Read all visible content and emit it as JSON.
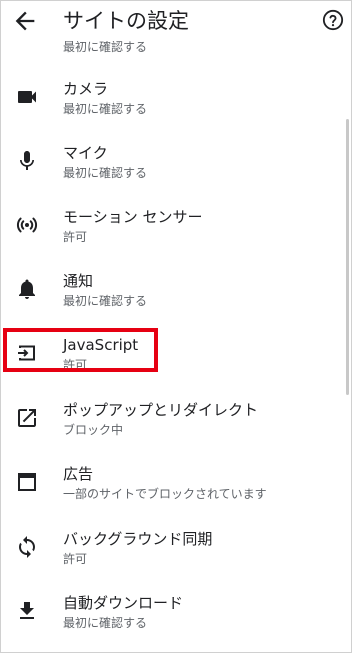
{
  "header": {
    "title": "サイトの設定",
    "back_icon": "arrow-back-icon",
    "help_icon": "help-circle-icon"
  },
  "cut_item": {
    "sub": "最初に確認する"
  },
  "items": [
    {
      "label": "カメラ",
      "sub": "最初に確認する",
      "icon": "camera-icon"
    },
    {
      "label": "マイク",
      "sub": "最初に確認する",
      "icon": "microphone-icon"
    },
    {
      "label": "モーション センサー",
      "sub": "許可",
      "icon": "motion-sensor-icon"
    },
    {
      "label": "通知",
      "sub": "最初に確認する",
      "icon": "bell-icon"
    },
    {
      "label": "JavaScript",
      "sub": "許可",
      "icon": "javascript-icon"
    },
    {
      "label": "ポップアップとリダイレクト",
      "sub": "ブロック中",
      "icon": "open-in-new-icon"
    },
    {
      "label": "広告",
      "sub": "一部のサイトでブロックされています",
      "icon": "ads-window-icon"
    },
    {
      "label": "バックグラウンド同期",
      "sub": "許可",
      "icon": "sync-icon"
    },
    {
      "label": "自動ダウンロード",
      "sub": "最初に確認する",
      "icon": "download-icon"
    }
  ],
  "colors": {
    "highlight": "#e60012",
    "icon": "#202124",
    "secondary_text": "#5f6368"
  }
}
